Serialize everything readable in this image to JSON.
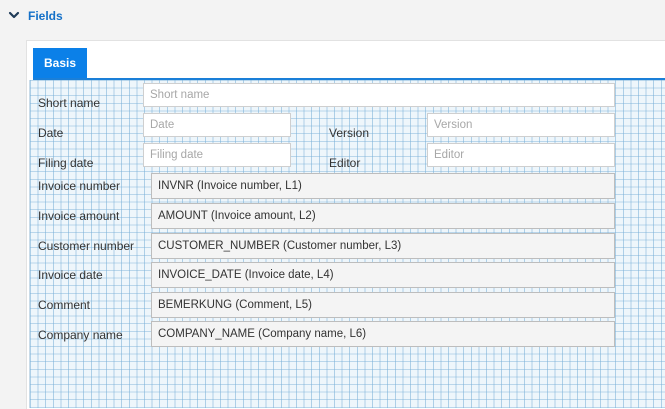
{
  "section": {
    "title": "Fields",
    "icon": "chevron-down-icon"
  },
  "tabs": [
    {
      "label": "Basis",
      "active": true
    }
  ],
  "form": {
    "short_name": {
      "label": "Short name",
      "placeholder": "Short name",
      "value": ""
    },
    "date": {
      "label": "Date",
      "placeholder": "Date",
      "value": ""
    },
    "version": {
      "label": "Version",
      "placeholder": "Version",
      "value": ""
    },
    "filing_date": {
      "label": "Filing date",
      "placeholder": "Filing date",
      "value": ""
    },
    "editor": {
      "label": "Editor",
      "placeholder": "Editor",
      "value": ""
    },
    "invoice_number": {
      "label": "Invoice number",
      "value": "INVNR (Invoice number, L1)"
    },
    "invoice_amount": {
      "label": "Invoice amount",
      "value": "AMOUNT (Invoice amount, L2)"
    },
    "customer_number": {
      "label": "Customer number",
      "value": "CUSTOMER_NUMBER (Customer number, L3)"
    },
    "invoice_date": {
      "label": "Invoice date",
      "value": "INVOICE_DATE (Invoice date, L4)"
    },
    "comment": {
      "label": "Comment",
      "value": "BEMERKUNG (Comment, L5)"
    },
    "company_name": {
      "label": "Company name",
      "value": "COMPANY_NAME (Company name, L6)"
    }
  },
  "colors": {
    "accent": "#0b80e8",
    "section_title": "#1470c8",
    "grid_background": "#eef6fb"
  }
}
